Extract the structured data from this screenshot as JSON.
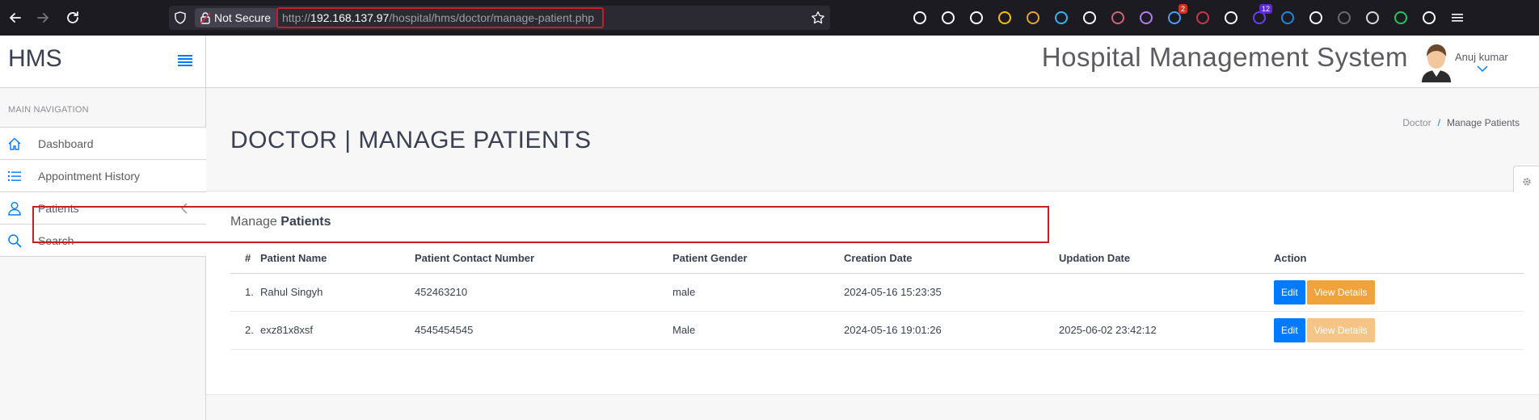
{
  "browser": {
    "security_label": "Not Secure",
    "url_prefix": "http://",
    "url_host": "192.168.137.97",
    "url_path": "/hospital/hms/doctor/manage-patient.php",
    "extensions": [
      {
        "icon": "pocket-icon"
      },
      {
        "icon": "account-icon"
      },
      {
        "icon": "puzzle-icon"
      },
      {
        "icon": "extension-icon"
      },
      {
        "icon": "cookie-icon"
      },
      {
        "icon": "link-icon"
      },
      {
        "icon": "cookie-editor-icon"
      },
      {
        "icon": "dots-icon"
      },
      {
        "icon": "mountain-icon"
      },
      {
        "icon": "proxy-icon",
        "badge": "2",
        "badge_color": "#d92d20"
      },
      {
        "icon": "dark-icon"
      },
      {
        "icon": "wappalyzer-icon"
      },
      {
        "icon": "purple-shield-icon",
        "badge": "12",
        "badge_color": "#5b2bd6"
      },
      {
        "icon": "w-icon"
      },
      {
        "icon": "mask-icon"
      },
      {
        "icon": "diamond-icon"
      },
      {
        "icon": "globe-icon"
      },
      {
        "icon": "w-green-icon"
      },
      {
        "icon": "extensions-icon"
      },
      {
        "icon": "menu-icon"
      }
    ]
  },
  "header": {
    "brand": "HMS",
    "app_title": "Hospital Management System",
    "user_name": "Anuj kumar"
  },
  "sidebar": {
    "heading": "MAIN NAVIGATION",
    "items": [
      {
        "label": "Dashboard",
        "icon": "home-icon"
      },
      {
        "label": "Appointment History",
        "icon": "list-icon"
      },
      {
        "label": "Patients",
        "icon": "user-icon"
      },
      {
        "label": "Search",
        "icon": "search-icon"
      }
    ]
  },
  "page": {
    "title": "DOCTOR | MANAGE PATIENTS",
    "breadcrumb": [
      "Doctor",
      "Manage Patients"
    ],
    "section_prefix": "Manage",
    "section_bold": "Patients"
  },
  "table": {
    "headers": [
      "#",
      "Patient Name",
      "Patient Contact Number",
      "Patient Gender",
      "Creation Date",
      "Updation Date",
      "Action"
    ],
    "rows": [
      {
        "num": "1.",
        "name": "Rahul Singyh",
        "contact": "452463210",
        "gender": "male",
        "created": "2024-05-16 15:23:35",
        "updated": "",
        "edit": "Edit",
        "view": "View Details"
      },
      {
        "num": "2.",
        "name": "exz81x8xsf",
        "contact": "4545454545",
        "gender": "Male",
        "created": "2024-05-16 19:01:26",
        "updated": "2025-06-02 23:42:12",
        "edit": "Edit",
        "view": "View Details"
      }
    ]
  },
  "colors": {
    "accent": "#007aff",
    "warning": "#f0a33a",
    "highlight": "#c81d25"
  }
}
